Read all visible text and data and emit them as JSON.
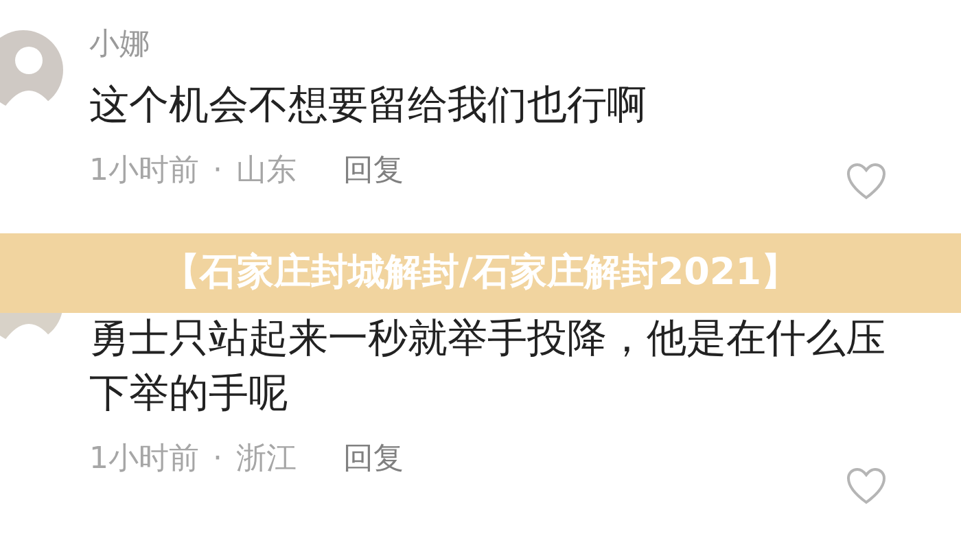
{
  "comments": [
    {
      "username": "小娜",
      "text": [
        "这个机会不想要留给我们也行啊"
      ],
      "time": "1小时前",
      "separator": "·",
      "location": "山东",
      "reply": "回复"
    },
    {
      "text": [
        "勇士只站起来一秒就举手投降，他是在什么压",
        "下举的手呢"
      ],
      "time": "1小时前",
      "separator": "·",
      "location": "浙江",
      "reply": "回复"
    }
  ],
  "banner": {
    "title": "【石家庄封城解封/石家庄解封2021】"
  }
}
